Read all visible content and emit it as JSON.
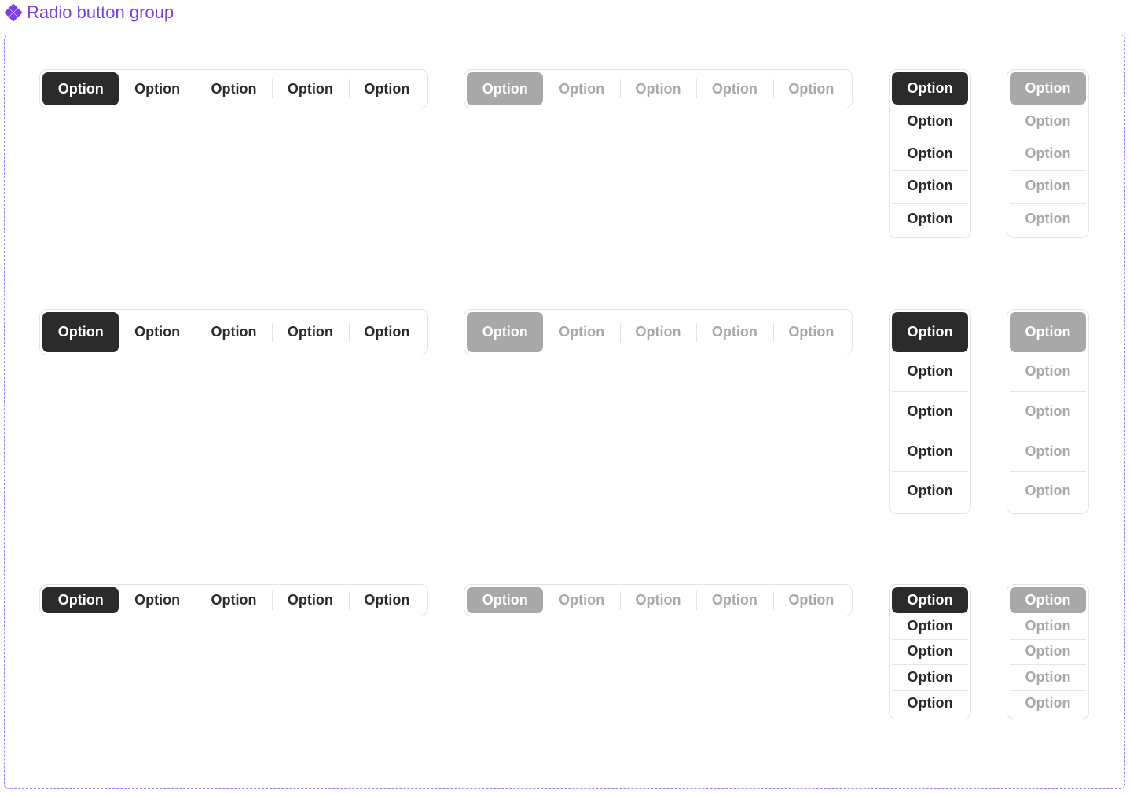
{
  "header": {
    "title": "Radio button group",
    "icon": "component-icon"
  },
  "colors": {
    "accent": "#7b3fe4",
    "selected": "#2b2b2b",
    "disabled_selected": "#a8a8a8",
    "disabled_text": "#a8a8a8",
    "border": "#e3e3e3"
  },
  "option_label": "Option",
  "rows": [
    {
      "size": "medium",
      "horizontal": {
        "options": [
          "Option",
          "Option",
          "Option",
          "Option",
          "Option"
        ],
        "selected": 0
      },
      "horizontal_disabled": {
        "options": [
          "Option",
          "Option",
          "Option",
          "Option",
          "Option"
        ],
        "selected": 0
      },
      "vertical": {
        "options": [
          "Option",
          "Option",
          "Option",
          "Option",
          "Option"
        ],
        "selected": 0
      },
      "vertical_disabled": {
        "options": [
          "Option",
          "Option",
          "Option",
          "Option",
          "Option"
        ],
        "selected": 0
      }
    },
    {
      "size": "large",
      "horizontal": {
        "options": [
          "Option",
          "Option",
          "Option",
          "Option",
          "Option"
        ],
        "selected": 0
      },
      "horizontal_disabled": {
        "options": [
          "Option",
          "Option",
          "Option",
          "Option",
          "Option"
        ],
        "selected": 0
      },
      "vertical": {
        "options": [
          "Option",
          "Option",
          "Option",
          "Option",
          "Option"
        ],
        "selected": 0
      },
      "vertical_disabled": {
        "options": [
          "Option",
          "Option",
          "Option",
          "Option",
          "Option"
        ],
        "selected": 0
      }
    },
    {
      "size": "small",
      "horizontal": {
        "options": [
          "Option",
          "Option",
          "Option",
          "Option",
          "Option"
        ],
        "selected": 0
      },
      "horizontal_disabled": {
        "options": [
          "Option",
          "Option",
          "Option",
          "Option",
          "Option"
        ],
        "selected": 0
      },
      "vertical": {
        "options": [
          "Option",
          "Option",
          "Option",
          "Option",
          "Option"
        ],
        "selected": 0
      },
      "vertical_disabled": {
        "options": [
          "Option",
          "Option",
          "Option",
          "Option",
          "Option"
        ],
        "selected": 0
      }
    }
  ]
}
